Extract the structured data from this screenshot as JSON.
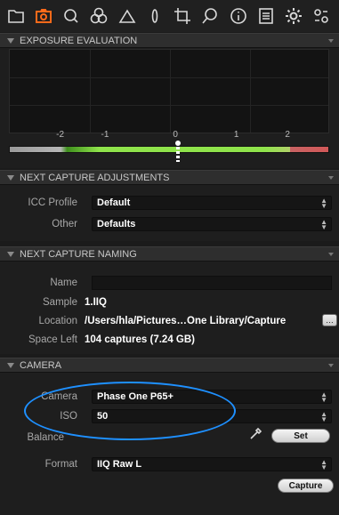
{
  "toolbar": {
    "icons": [
      "folder-icon",
      "camera-icon",
      "search-icon",
      "color-icon",
      "exposure-icon",
      "lens-icon",
      "crop-icon",
      "details-icon",
      "info-icon",
      "output-icon",
      "gear-icon",
      "batch-icon"
    ],
    "active": "camera-icon",
    "accent": "#ff6a1a"
  },
  "exposure_evaluation": {
    "title": "EXPOSURE EVALUATION",
    "scale": [
      "-2",
      "-1",
      "0",
      "1",
      "2"
    ],
    "marker_value": 0.0
  },
  "next_capture_adjustments": {
    "title": "NEXT CAPTURE ADJUSTMENTS",
    "icc_profile_label": "ICC Profile",
    "icc_profile_value": "Default",
    "other_label": "Other",
    "other_value": "Defaults"
  },
  "next_capture_naming": {
    "title": "NEXT CAPTURE NAMING",
    "name_label": "Name",
    "name_value": "",
    "sample_label": "Sample",
    "sample_value": "1.IIQ",
    "location_label": "Location",
    "location_value": "/Users/hla/Pictures…One Library/Capture",
    "browse_label": "…",
    "space_left_label": "Space Left",
    "space_left_value": "104 captures (7.24 GB)"
  },
  "camera": {
    "title": "CAMERA",
    "camera_label": "Camera",
    "camera_value": "Phase One P65+",
    "iso_label": "ISO",
    "iso_value": "50",
    "balance_label": "Balance",
    "set_label": "Set",
    "format_label": "Format",
    "format_value": "IIQ Raw L",
    "capture_label": "Capture",
    "highlight_color": "#1e90ff"
  }
}
